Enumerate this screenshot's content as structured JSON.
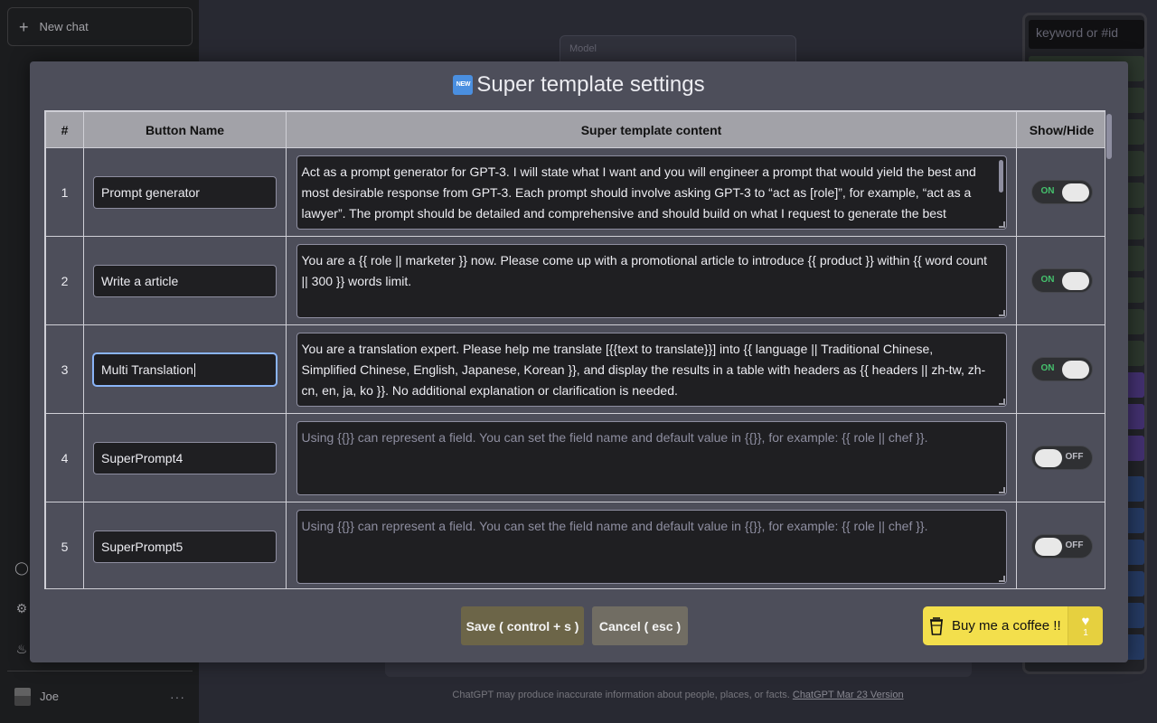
{
  "sidebar": {
    "new_chat_label": "New chat",
    "user_name": "Joe",
    "more_glyph": "···"
  },
  "main": {
    "model_label": "Model",
    "footer_text": "ChatGPT may produce inaccurate information about people, places, or facts.",
    "footer_link": "ChatGPT Mar 23 Version"
  },
  "right_panel": {
    "search_placeholder": "keyword or #id"
  },
  "modal": {
    "badge_text": "NEW",
    "title": "Super template settings",
    "columns": [
      "#",
      "Button Name",
      "Super template content",
      "Show/Hide"
    ],
    "rows": [
      {
        "num": "1",
        "name": "Prompt generator",
        "content": "Act as a prompt generator for GPT-3. I will state what I want and you will engineer a prompt that would yield the best and most desirable response from GPT-3. Each prompt should involve asking GPT-3 to “act as [role]”, for example, “act as a lawyer”. The prompt should be detailed and comprehensive and should build on what I request to generate the best possible response from",
        "toggle": "ON"
      },
      {
        "num": "2",
        "name": "Write a article",
        "content": "You are a {{ role || marketer }} now. Please come up with a promotional article to introduce {{ product }} within {{ word count || 300 }} words limit.",
        "toggle": "ON"
      },
      {
        "num": "3",
        "name": "Multi Translation",
        "content": "You are a translation expert. Please help me translate [{{text to translate}}] into {{ language || Traditional Chinese, Simplified Chinese, English, Japanese, Korean }}, and display the results in a table with headers as {{ headers || zh-tw, zh-cn, en, ja, ko }}. No additional explanation or clarification is needed.",
        "toggle": "ON"
      },
      {
        "num": "4",
        "name": "SuperPrompt4",
        "placeholder": "Using {{}} can represent a field. You can set the field name and default value in {{}}, for example: {{ role || chef }}.",
        "toggle": "OFF"
      },
      {
        "num": "5",
        "name": "SuperPrompt5",
        "placeholder": "Using {{}} can represent a field. You can set the field name and default value in {{}}, for example: {{ role || chef }}.",
        "toggle": "OFF"
      }
    ],
    "save_label": "Save ( control + s )",
    "cancel_label": "Cancel ( esc )",
    "coffee_label": "Buy me a coffee !!",
    "coffee_count": "1"
  },
  "colors": {
    "accent_yellow": "#f3df4c",
    "toggle_on": "#45c16d",
    "modal_bg": "#4d4e5a",
    "header_bg": "#a2a2a8"
  }
}
